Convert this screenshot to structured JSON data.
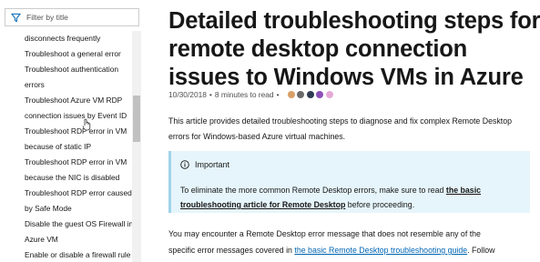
{
  "sidebar": {
    "filter_placeholder": "Filter by title",
    "items": [
      {
        "lines": [
          "disconnects frequently"
        ]
      },
      {
        "lines": [
          "Troubleshoot a general error"
        ]
      },
      {
        "lines": [
          "Troubleshoot authentication",
          "errors"
        ]
      },
      {
        "lines": [
          "Troubleshoot Azure VM RDP",
          "connection issues by Event ID"
        ]
      },
      {
        "lines": [
          "Troubleshoot RDP error in VM",
          "because of static IP"
        ]
      },
      {
        "lines": [
          "Troubleshoot RDP error in VM",
          "because the NIC is disabled"
        ]
      },
      {
        "lines": [
          "Troubleshoot RDP error caused",
          "by Safe Mode"
        ]
      },
      {
        "lines": [
          "Disable the guest OS Firewall in",
          "Azure VM"
        ]
      },
      {
        "lines": [
          "Enable or disable a firewall rule"
        ]
      }
    ]
  },
  "article": {
    "title": "Detailed troubleshooting steps for remote desktop connection issues to Windows VMs in Azure",
    "date": "10/30/2018",
    "separator": "•",
    "read_time": "8 minutes to read",
    "contributors_separator": "•",
    "intro": "This article provides detailed troubleshooting steps to diagnose and fix complex Remote Desktop errors for Windows-based Azure virtual machines.",
    "alert": {
      "heading": "Important",
      "text_before": "To eliminate the more common Remote Desktop errors, make sure to read ",
      "link": "the basic troubleshooting article for Remote Desktop",
      "text_after": " before proceeding."
    },
    "para": {
      "line1": "You may encounter a Remote Desktop error message that does not resemble any of the",
      "line2_before": "specific error messages covered in ",
      "line2_link": "the basic Remote Desktop troubleshooting guide",
      "line2_after": ". Follow"
    }
  },
  "colors": {
    "accent": "#0065b3",
    "alert_bg": "#e6f5fb",
    "alert_border": "#9fd3ea"
  },
  "icons": [
    "filter-icon",
    "info-icon",
    "contributor-avatar"
  ]
}
